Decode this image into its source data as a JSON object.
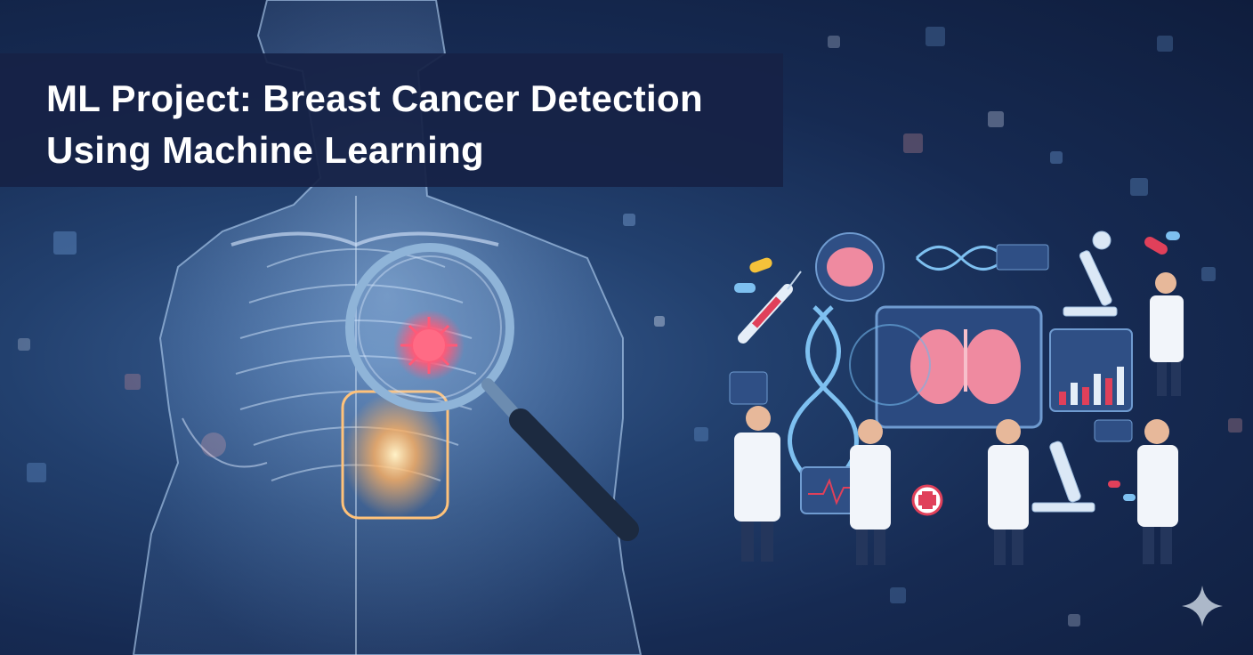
{
  "title": {
    "line1": "ML Project: Breast Cancer Detection",
    "line2": "Using Machine Learning"
  },
  "colors": {
    "banner_bg": "#162246",
    "background": "#162a52",
    "accent_glow": "#ffb060",
    "tumor": "#ff4d6d",
    "lab_coat": "#f2f5fa"
  },
  "icons": [
    "magnifying-glass-icon",
    "dna-icon",
    "brain-icon",
    "microscope-icon",
    "syringe-icon",
    "pill-icon",
    "lungs-icon",
    "bar-chart-icon",
    "medical-cross-icon",
    "sparkle-icon"
  ]
}
